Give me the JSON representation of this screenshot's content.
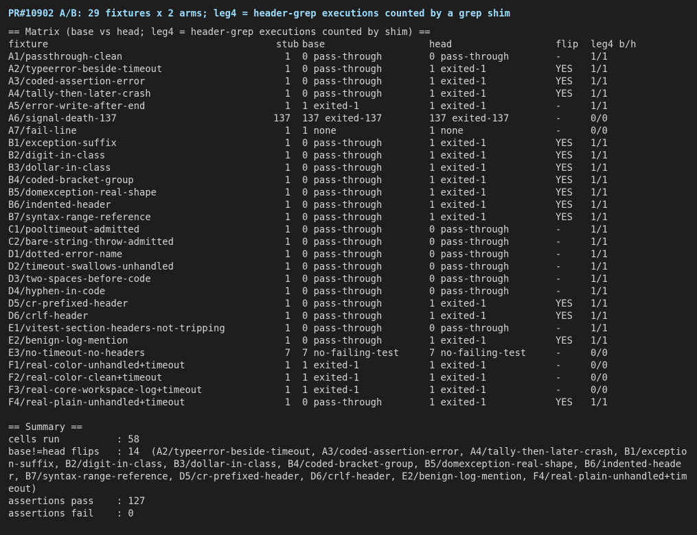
{
  "title": "PR#10902 A/B: 29 fixtures x 2 arms; leg4 = header-grep executions counted by a grep shim",
  "matrix_heading": "== Matrix (base vs head; leg4 = header-grep executions counted by shim) ==",
  "columns": {
    "fixture": "fixture",
    "stub": "stub",
    "base": "base",
    "head": "head",
    "flip": "flip",
    "leg4": "leg4 b/h"
  },
  "rows": [
    {
      "fixture": "A1/passthrough-clean",
      "stub": "1",
      "base": "0 pass-through",
      "head": "0 pass-through",
      "flip": "-",
      "leg4": "1/1"
    },
    {
      "fixture": "A2/typeerror-beside-timeout",
      "stub": "1",
      "base": "0 pass-through",
      "head": "1 exited-1",
      "flip": "YES",
      "leg4": "1/1"
    },
    {
      "fixture": "A3/coded-assertion-error",
      "stub": "1",
      "base": "0 pass-through",
      "head": "1 exited-1",
      "flip": "YES",
      "leg4": "1/1"
    },
    {
      "fixture": "A4/tally-then-later-crash",
      "stub": "1",
      "base": "0 pass-through",
      "head": "1 exited-1",
      "flip": "YES",
      "leg4": "1/1"
    },
    {
      "fixture": "A5/error-write-after-end",
      "stub": "1",
      "base": "1 exited-1",
      "head": "1 exited-1",
      "flip": "-",
      "leg4": "1/1"
    },
    {
      "fixture": "A6/signal-death-137",
      "stub": "137",
      "base": "137 exited-137",
      "head": "137 exited-137",
      "flip": "-",
      "leg4": "0/0"
    },
    {
      "fixture": "A7/fail-line",
      "stub": "1",
      "base": "1 none",
      "head": "1 none",
      "flip": "-",
      "leg4": "0/0"
    },
    {
      "fixture": "B1/exception-suffix",
      "stub": "1",
      "base": "0 pass-through",
      "head": "1 exited-1",
      "flip": "YES",
      "leg4": "1/1"
    },
    {
      "fixture": "B2/digit-in-class",
      "stub": "1",
      "base": "0 pass-through",
      "head": "1 exited-1",
      "flip": "YES",
      "leg4": "1/1"
    },
    {
      "fixture": "B3/dollar-in-class",
      "stub": "1",
      "base": "0 pass-through",
      "head": "1 exited-1",
      "flip": "YES",
      "leg4": "1/1"
    },
    {
      "fixture": "B4/coded-bracket-group",
      "stub": "1",
      "base": "0 pass-through",
      "head": "1 exited-1",
      "flip": "YES",
      "leg4": "1/1"
    },
    {
      "fixture": "B5/domexception-real-shape",
      "stub": "1",
      "base": "0 pass-through",
      "head": "1 exited-1",
      "flip": "YES",
      "leg4": "1/1"
    },
    {
      "fixture": "B6/indented-header",
      "stub": "1",
      "base": "0 pass-through",
      "head": "1 exited-1",
      "flip": "YES",
      "leg4": "1/1"
    },
    {
      "fixture": "B7/syntax-range-reference",
      "stub": "1",
      "base": "0 pass-through",
      "head": "1 exited-1",
      "flip": "YES",
      "leg4": "1/1"
    },
    {
      "fixture": "C1/pooltimeout-admitted",
      "stub": "1",
      "base": "0 pass-through",
      "head": "0 pass-through",
      "flip": "-",
      "leg4": "1/1"
    },
    {
      "fixture": "C2/bare-string-throw-admitted",
      "stub": "1",
      "base": "0 pass-through",
      "head": "0 pass-through",
      "flip": "-",
      "leg4": "1/1"
    },
    {
      "fixture": "D1/dotted-error-name",
      "stub": "1",
      "base": "0 pass-through",
      "head": "0 pass-through",
      "flip": "-",
      "leg4": "1/1"
    },
    {
      "fixture": "D2/timeout-swallows-unhandled",
      "stub": "1",
      "base": "0 pass-through",
      "head": "0 pass-through",
      "flip": "-",
      "leg4": "1/1"
    },
    {
      "fixture": "D3/two-spaces-before-code",
      "stub": "1",
      "base": "0 pass-through",
      "head": "0 pass-through",
      "flip": "-",
      "leg4": "1/1"
    },
    {
      "fixture": "D4/hyphen-in-code",
      "stub": "1",
      "base": "0 pass-through",
      "head": "0 pass-through",
      "flip": "-",
      "leg4": "1/1"
    },
    {
      "fixture": "D5/cr-prefixed-header",
      "stub": "1",
      "base": "0 pass-through",
      "head": "1 exited-1",
      "flip": "YES",
      "leg4": "1/1"
    },
    {
      "fixture": "D6/crlf-header",
      "stub": "1",
      "base": "0 pass-through",
      "head": "1 exited-1",
      "flip": "YES",
      "leg4": "1/1"
    },
    {
      "fixture": "E1/vitest-section-headers-not-tripping",
      "stub": "1",
      "base": "0 pass-through",
      "head": "0 pass-through",
      "flip": "-",
      "leg4": "1/1"
    },
    {
      "fixture": "E2/benign-log-mention",
      "stub": "1",
      "base": "0 pass-through",
      "head": "1 exited-1",
      "flip": "YES",
      "leg4": "1/1"
    },
    {
      "fixture": "E3/no-timeout-no-headers",
      "stub": "7",
      "base": "7 no-failing-test",
      "head": "7 no-failing-test",
      "flip": "-",
      "leg4": "0/0"
    },
    {
      "fixture": "F1/real-color-unhandled+timeout",
      "stub": "1",
      "base": "1 exited-1",
      "head": "1 exited-1",
      "flip": "-",
      "leg4": "0/0"
    },
    {
      "fixture": "F2/real-color-clean+timeout",
      "stub": "1",
      "base": "1 exited-1",
      "head": "1 exited-1",
      "flip": "-",
      "leg4": "0/0"
    },
    {
      "fixture": "F3/real-core-workspace-log+timeout",
      "stub": "1",
      "base": "1 exited-1",
      "head": "1 exited-1",
      "flip": "-",
      "leg4": "0/0"
    },
    {
      "fixture": "F4/real-plain-unhandled+timeout",
      "stub": "1",
      "base": "0 pass-through",
      "head": "1 exited-1",
      "flip": "YES",
      "leg4": "1/1"
    }
  ],
  "summary": {
    "heading": "== Summary ==",
    "cells_run": "cells run          : 58",
    "flips": "base!=head flips   : 14  (A2/typeerror-beside-timeout, A3/coded-assertion-error, A4/tally-then-later-crash, B1/exception-suffix, B2/digit-in-class, B3/dollar-in-class, B4/coded-bracket-group, B5/domexception-real-shape, B6/indented-header, B7/syntax-range-reference, D5/cr-prefixed-header, D6/crlf-header, E2/benign-log-mention, F4/real-plain-unhandled+timeout)",
    "assertions_pass": "assertions pass    : 127",
    "assertions_fail": "assertions fail    : 0"
  },
  "colors": {
    "background": "#1e1e1e",
    "text": "#d4d4d4",
    "title": "#9cdcfe"
  }
}
